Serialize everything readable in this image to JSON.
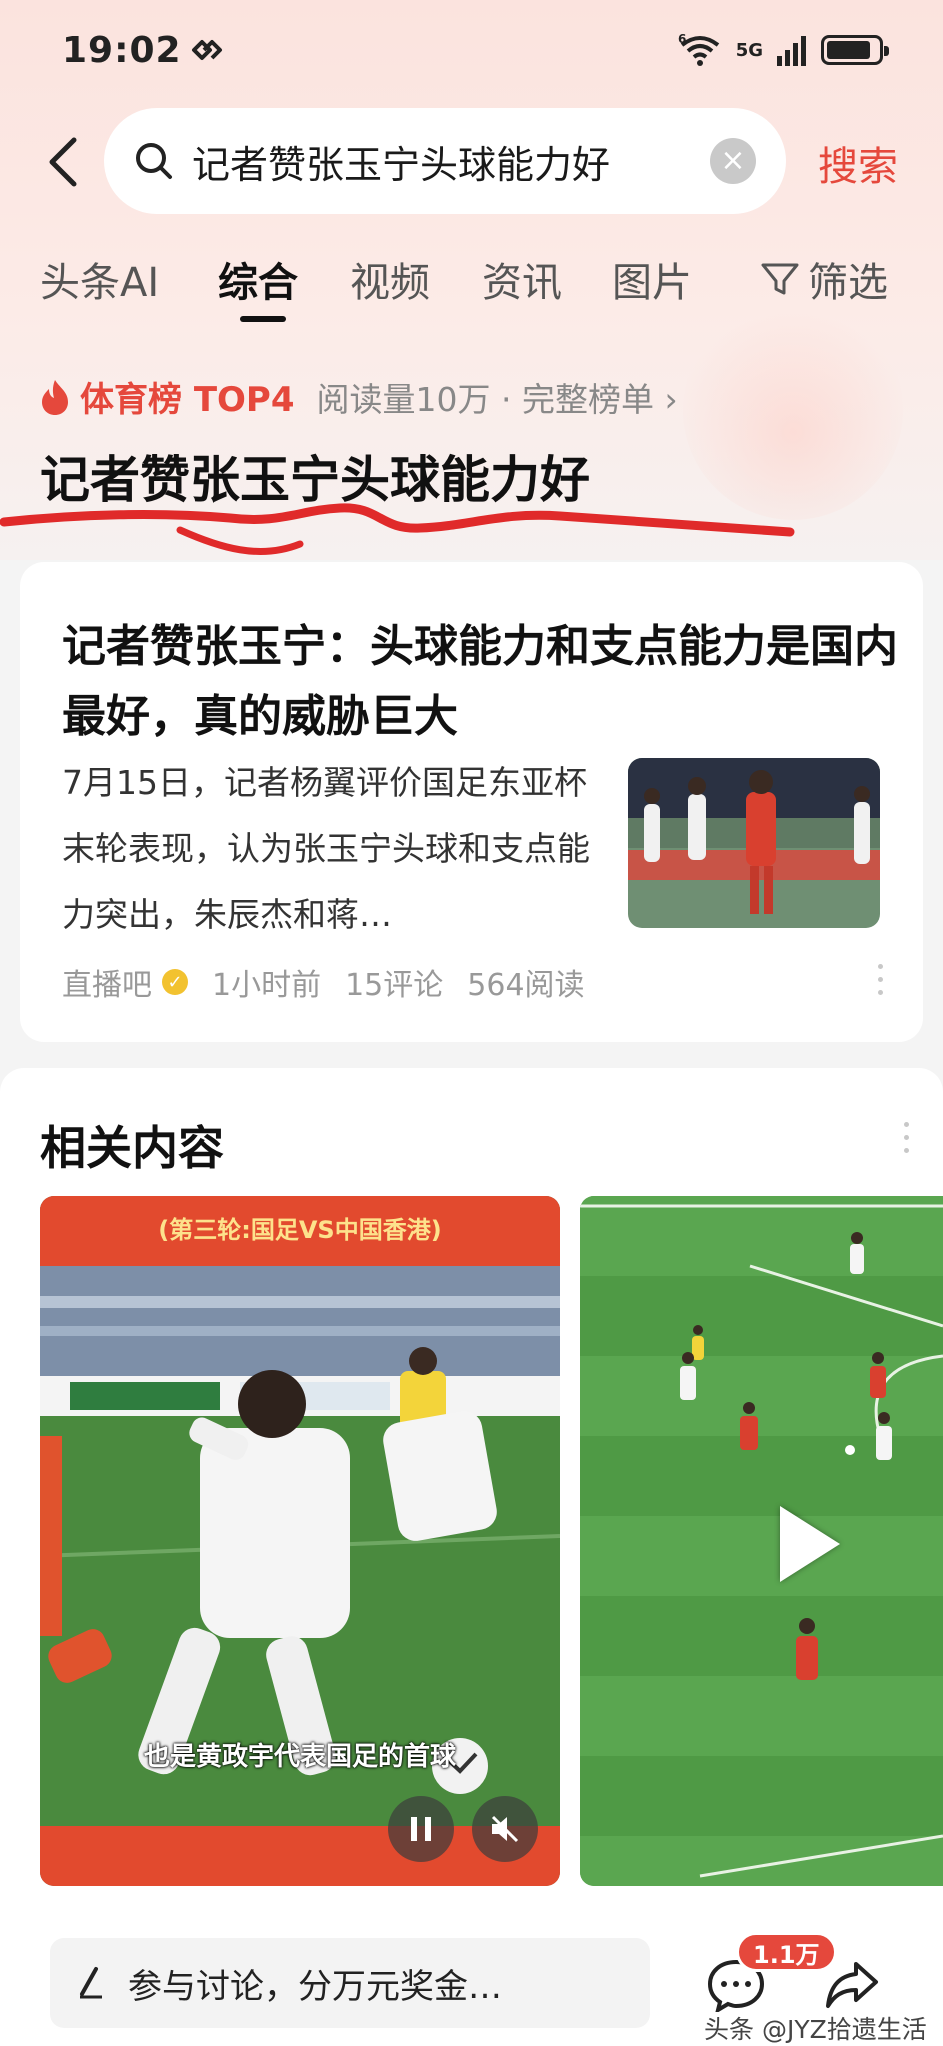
{
  "status_bar": {
    "time": "19:02",
    "network": "5G",
    "wifi_label": "6",
    "battery_level": 0.85
  },
  "search": {
    "query": "记者赞张玉宁头球能力好",
    "action_label": "搜索"
  },
  "tabs": [
    {
      "label": "头条AI",
      "active": false
    },
    {
      "label": "综合",
      "active": true
    },
    {
      "label": "视频",
      "active": false
    },
    {
      "label": "资讯",
      "active": false
    },
    {
      "label": "图片",
      "active": false
    },
    {
      "label": "筛选",
      "active": false
    }
  ],
  "hot_rank": {
    "name": "体育榜 TOP4",
    "meta": "阅读量10万 · 完整榜单 ›",
    "title": "记者赞张玉宁头球能力好"
  },
  "article": {
    "title": "记者赞张玉宁：头球能力和支点能力是国内最好，真的威胁巨大",
    "summary": "7月15日，记者杨翼评价国足东亚杯末轮表现，认为张玉宁头球和支点能力突出，朱辰杰和蒋…",
    "source": "直播吧",
    "time": "1小时前",
    "comments": "15评论",
    "reads": "564阅读"
  },
  "related": {
    "title": "相关内容",
    "videos": [
      {
        "banner": "(第三轮:国足VS中国香港)",
        "caption": "也是黄政宇代表国足的首球"
      },
      {
        "banner": "",
        "caption": ""
      }
    ]
  },
  "bottom_bar": {
    "comment_placeholder": "参与讨论，分万元奖金…",
    "comment_count": "1.1万",
    "watermark": "头条 @JYZ拾遗生活"
  },
  "colors": {
    "accent": "#e5483c",
    "scribble": "#e02a2a"
  }
}
